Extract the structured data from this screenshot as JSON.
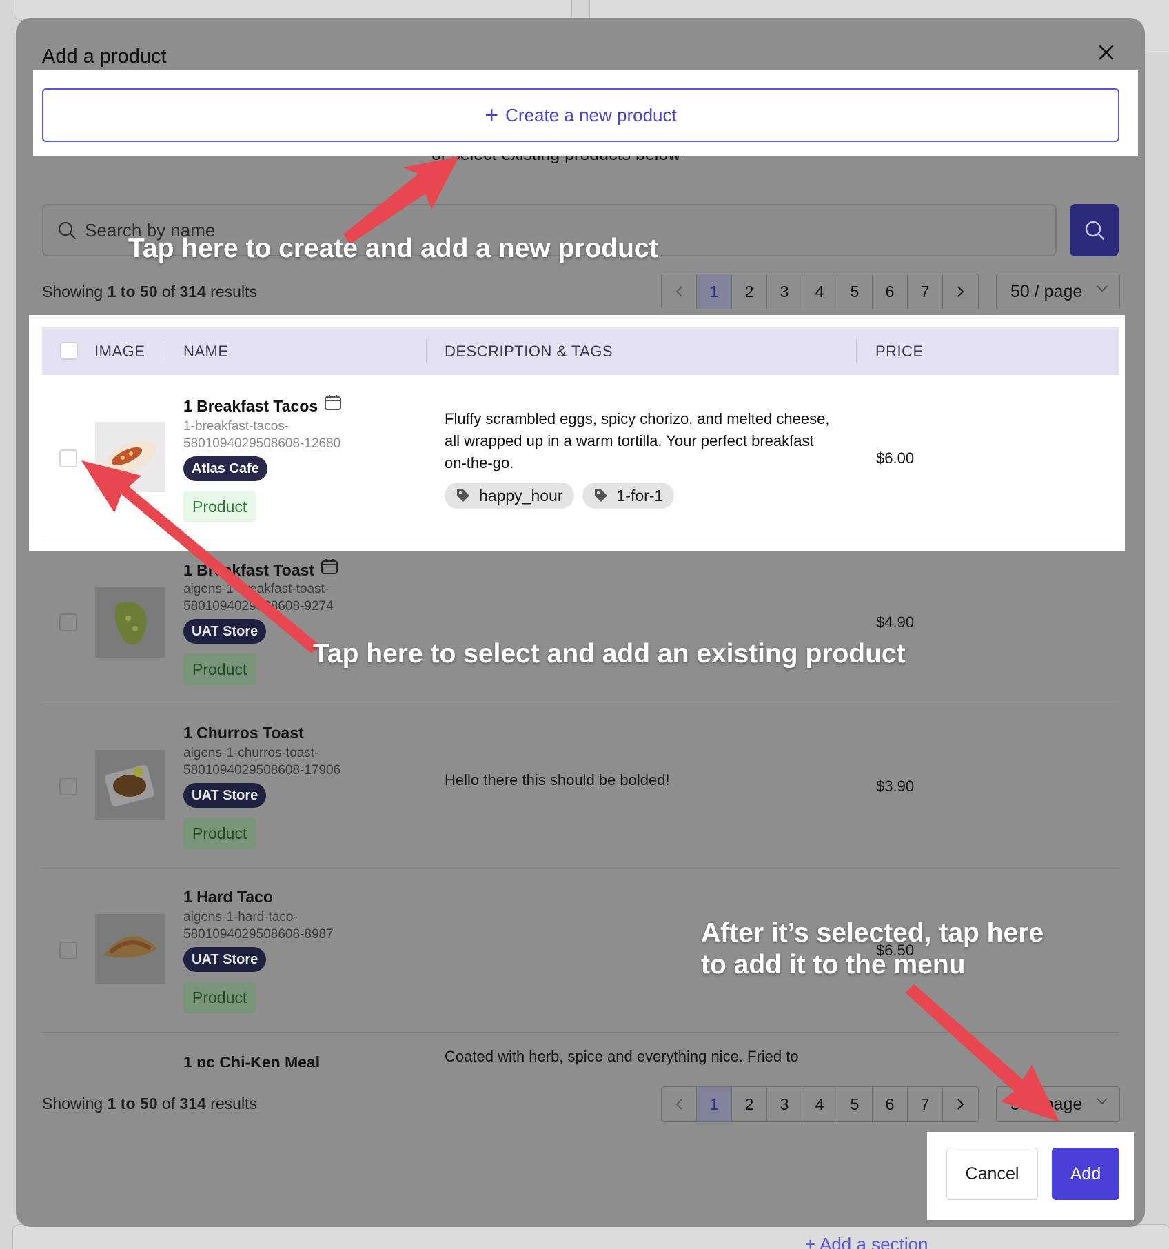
{
  "modal": {
    "title": "Add a product",
    "create_button_label": "Create a new product",
    "subtext": "or select existing products below",
    "search_placeholder": "Search by name"
  },
  "summary": {
    "prefix": "Showing",
    "range": "1 to 50",
    "of": "of",
    "total": "314",
    "suffix": "results"
  },
  "pagination": {
    "pages": [
      "1",
      "2",
      "3",
      "4",
      "5",
      "6",
      "7"
    ],
    "active_page": "1",
    "page_size_label": "50 / page"
  },
  "table": {
    "headers": {
      "image": "IMAGE",
      "name": "NAME",
      "description": "DESCRIPTION & TAGS",
      "price": "PRICE"
    },
    "rows": [
      {
        "name": "1 Breakfast Tacos",
        "slug": "1-breakfast-tacos-5801094029508608-12680",
        "store": "Atlas Cafe",
        "type": "Product",
        "description": "Fluffy scrambled eggs, spicy chorizo, and melted cheese, all wrapped up in a warm tortilla. Your perfect breakfast on-the-go.",
        "tags": [
          "happy_hour",
          "1-for-1"
        ],
        "price": "$6.00"
      },
      {
        "name": "1 Breakfast Toast",
        "slug": "aigens-1-breakfast-toast-5801094029508608-9274",
        "store": "UAT Store",
        "type": "Product",
        "description": "",
        "tags": [],
        "price": "$4.90"
      },
      {
        "name": "1 Churros Toast",
        "slug": "aigens-1-churros-toast-5801094029508608-17906",
        "store": "UAT Store",
        "type": "Product",
        "description": "Hello there this should be bolded!",
        "tags": [],
        "price": "$3.90"
      },
      {
        "name": "1 Hard Taco",
        "slug": "aigens-1-hard-taco-5801094029508608-8987",
        "store": "UAT Store",
        "type": "Product",
        "description": "",
        "tags": [],
        "price": "$6.50"
      },
      {
        "name": "1 pc Chi-Ken Meal",
        "description": "Coated with herb, spice and everything nice. Fried to"
      }
    ]
  },
  "footer": {
    "cancel_label": "Cancel",
    "add_label": "Add"
  },
  "annotations": {
    "create": "Tap here to create and add a new product",
    "select": "Tap here to select and add an existing product",
    "add_line1": "After it’s selected, tap here",
    "add_line2": "to add it to the menu"
  },
  "background": {
    "add_section": "+ Add a section"
  },
  "colors": {
    "accent": "#4a3fd9",
    "arrow": "#e8474f",
    "header_bg": "#e3e2f2"
  }
}
